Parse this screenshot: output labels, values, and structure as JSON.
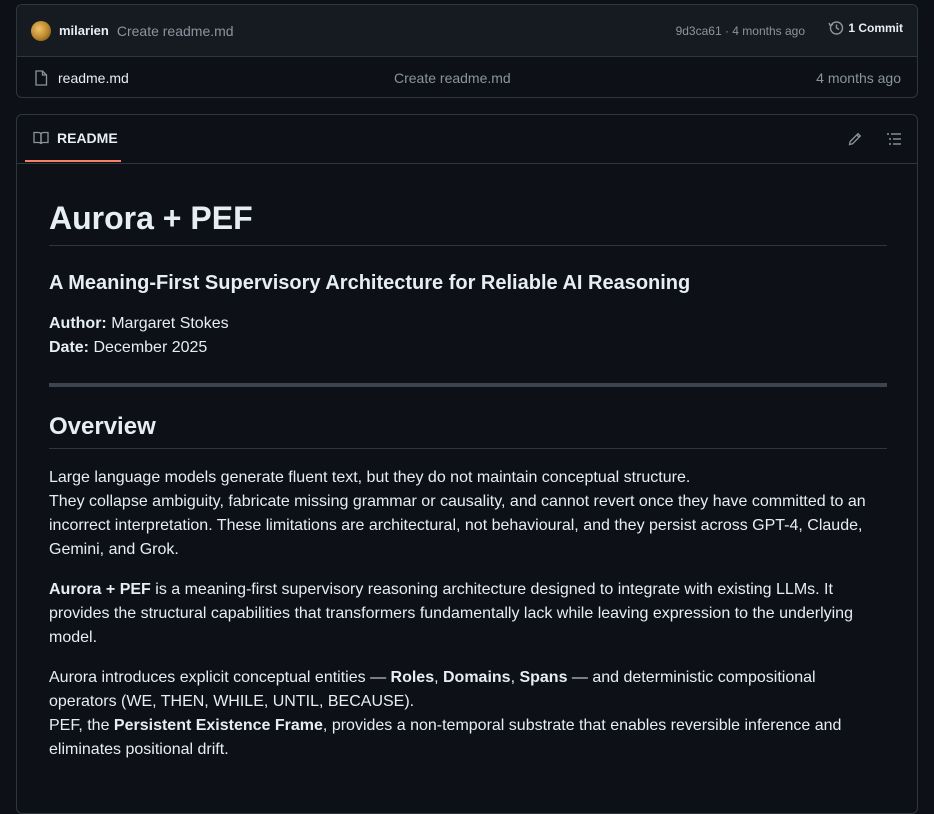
{
  "commit_bar": {
    "author": "milarien",
    "message": "Create readme.md",
    "meta": "9d3ca61 · 4 months ago",
    "commits_label": "1 Commit"
  },
  "files": [
    {
      "name": "readme.md",
      "commit_message": "Create readme.md",
      "time": "4 months ago"
    }
  ],
  "readme": {
    "tab_label": "README",
    "title": "Aurora + PEF",
    "subtitle": "A Meaning-First Supervisory Architecture for Reliable AI Reasoning",
    "author_label": "Author:",
    "author_value": "Margaret Stokes",
    "date_label": "Date:",
    "date_value": "December 2025",
    "overview_heading": "Overview",
    "p1_line1": "Large language models generate fluent text, but they do not maintain conceptual structure.",
    "p1_rest": "They collapse ambiguity, fabricate missing grammar or causality, and cannot revert once they have committed to an incorrect interpretation. These limitations are architectural, not behavioural, and they persist across GPT-4, Claude, Gemini, and Grok.",
    "p2_bold": "Aurora + PEF",
    "p2_text": " is a meaning-first supervisory reasoning architecture designed to integrate with existing LLMs. It provides the structural capabilities that transformers fundamentally lack while leaving expression to the underlying model.",
    "p3_a": "Aurora introduces explicit conceptual entities — ",
    "p3_roles": "Roles",
    "p3_sep1": ", ",
    "p3_domains": "Domains",
    "p3_sep2": ", ",
    "p3_spans": "Spans",
    "p3_b": " — and deterministic compositional operators (WE, THEN, WHILE, UNTIL, BECAUSE).",
    "p4_a": "PEF, the ",
    "p4_bold": "Persistent Existence Frame",
    "p4_b": ", provides a non-temporal substrate that enables reversible inference and eliminates positional drift."
  }
}
